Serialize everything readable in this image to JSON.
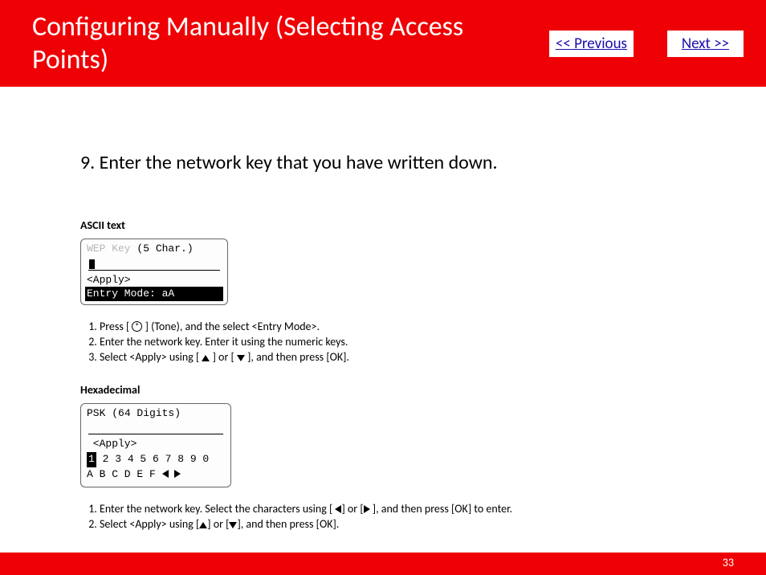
{
  "header": {
    "title": "Configuring Manually (Selecting Access Points)",
    "prev_label": "<< Previous",
    "next_label": "Next >>"
  },
  "main": {
    "heading": "9. Enter the network key that you have written down.",
    "ascii": {
      "label": "ASCII text",
      "lcd": {
        "line1_grey": "WEP Key ",
        "line1_rest": "(5 Char.)",
        "apply": "<Apply>",
        "entry": "Entry Mode: aA"
      },
      "steps": [
        {
          "pre": "Press [ ",
          "icon": "tone",
          "post": " ] (Tone), and the select <Entry Mode>."
        },
        {
          "text": "Enter the network key. Enter it using the numeric keys."
        },
        {
          "pre": "Select <Apply> using [ ",
          "icon1": "up",
          "mid": " ] or [ ",
          "icon2": "down",
          "post": " ], and then press [OK]."
        }
      ]
    },
    "hex": {
      "label": "Hexadecimal",
      "lcd": {
        "line1_grey": "PSK ",
        "line1_rest": "(64 Digits)",
        "apply": " <Apply>",
        "digits_first": "1",
        "digits_rest": " 2 3 4 5 6 7 8 9 0",
        "letters": "A B C D E F"
      },
      "steps": [
        {
          "pre": "Enter the network key. Select the characters using [ ",
          "icon1": "left",
          "mid": "] or [",
          "icon2": "right",
          "post": "  ], and then press [OK] to enter."
        },
        {
          "pre": "Select <Apply> using [",
          "icon1": "up",
          "mid": "] or [",
          "icon2": "down",
          "post": "], and then press [OK]."
        }
      ]
    }
  },
  "footer": {
    "page": "33"
  }
}
